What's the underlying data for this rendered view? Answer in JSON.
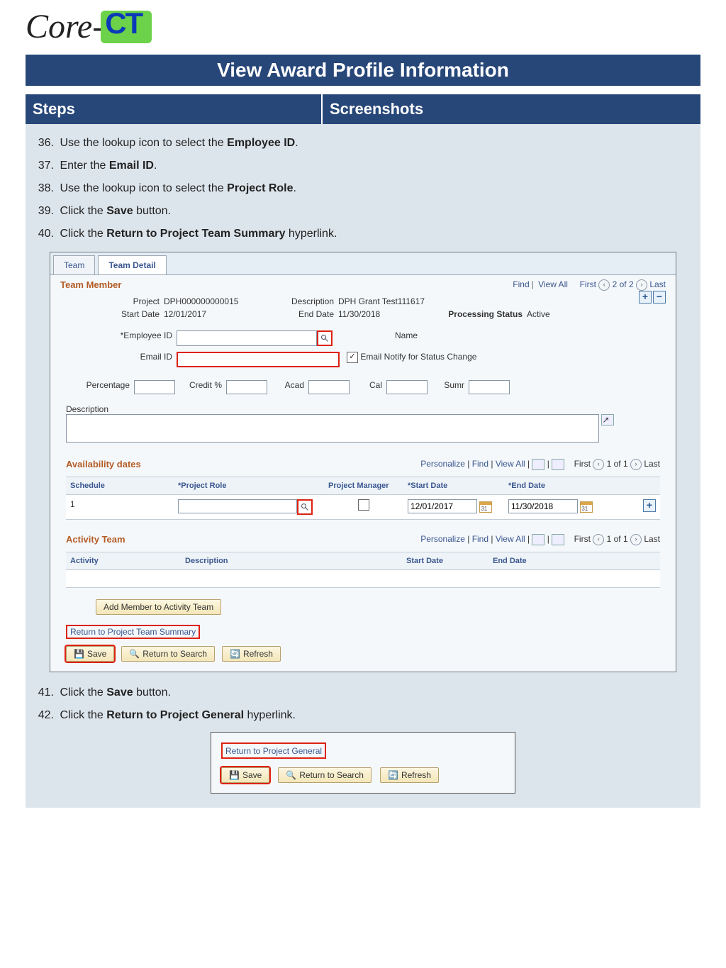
{
  "logo": {
    "text": "Core-",
    "badge": "CT"
  },
  "banner": "View Award Profile Information",
  "columns": {
    "left": "Steps",
    "right": "Screenshots"
  },
  "steps_a": [
    {
      "n": "36.",
      "pre": "Use the lookup icon to select the ",
      "bold": "Employee ID",
      "post": "."
    },
    {
      "n": "37.",
      "pre": "Enter the ",
      "bold": "Email ID",
      "post": "."
    },
    {
      "n": "38.",
      "pre": "Use the lookup icon to select the ",
      "bold": "Project Role",
      "post": "."
    },
    {
      "n": "39.",
      "pre": "Click the ",
      "bold": "Save",
      "post": " button."
    },
    {
      "n": "40.",
      "pre": "Click the ",
      "bold": "Return to Project Team Summary",
      "post": " hyperlink."
    }
  ],
  "steps_b": [
    {
      "n": "41.",
      "pre": "Click the ",
      "bold": "Save",
      "post": " button."
    },
    {
      "n": "42.",
      "pre": "Click the ",
      "bold": "Return to Project General",
      "post": " hyperlink."
    }
  ],
  "app": {
    "tabs": {
      "team": "Team",
      "detail": "Team Detail"
    },
    "team_member": {
      "title": "Team Member",
      "find": "Find",
      "viewall": "View All",
      "first": "First",
      "pager": "2 of 2",
      "last": "Last",
      "plus": "+",
      "minus": "−"
    },
    "fields": {
      "project_lbl": "Project",
      "project_val": "DPH000000000015",
      "description_lbl": "Description",
      "description_val": "DPH Grant Test111617",
      "startdate_lbl": "Start Date",
      "startdate_val": "12/01/2017",
      "enddate_lbl": "End Date",
      "enddate_val": "11/30/2018",
      "procstatus_lbl": "Processing Status",
      "procstatus_val": "Active",
      "empid_lbl": "*Employee ID",
      "empid_val": "",
      "name_lbl": "Name",
      "email_lbl": "Email ID",
      "email_val": "",
      "emailnotify_lbl": "Email Notify for Status Change",
      "pct_lbl": "Percentage",
      "pct_val": "",
      "credit_lbl": "Credit %",
      "credit_val": "",
      "acad_lbl": "Acad",
      "acad_val": "",
      "cal_lbl": "Cal",
      "cal_val": "",
      "sumr_lbl": "Sumr",
      "sumr_val": "",
      "desc2_lbl": "Description",
      "desc2_val": ""
    },
    "avail": {
      "title": "Availability dates",
      "personalize": "Personalize",
      "find": "Find",
      "viewall": "View All",
      "first": "First",
      "pager": "1 of 1",
      "last": "Last",
      "hdr_schedule": "Schedule",
      "hdr_role": "*Project Role",
      "hdr_pm": "Project Manager",
      "hdr_start": "*Start Date",
      "hdr_end": "*End Date",
      "row": {
        "schedule": "1",
        "role": "",
        "start": "12/01/2017",
        "end": "11/30/2018"
      },
      "add": "+"
    },
    "actteam": {
      "title": "Activity Team",
      "personalize": "Personalize",
      "find": "Find",
      "viewall": "View All",
      "first": "First",
      "pager": "1 of 1",
      "last": "Last",
      "hdr_activity": "Activity",
      "hdr_desc": "Description",
      "hdr_start": "Start Date",
      "hdr_end": "End Date"
    },
    "buttons": {
      "add_member": "Add Member to Activity Team",
      "return_summary": "Return to Project Team Summary",
      "save": "Save",
      "return_search": "Return to Search",
      "refresh": "Refresh"
    }
  },
  "snippet": {
    "return_general": "Return to Project General",
    "save": "Save",
    "return_search": "Return to Search",
    "refresh": "Refresh"
  }
}
